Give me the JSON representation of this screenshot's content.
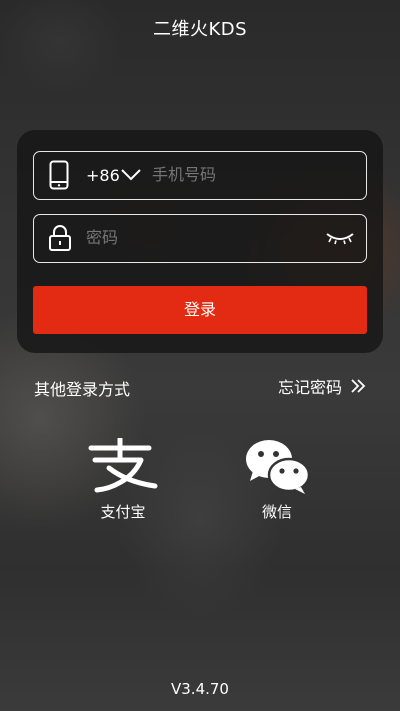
{
  "header": {
    "title": "二维火KDS"
  },
  "login": {
    "country_code": "+86",
    "phone_placeholder": "手机号码",
    "password_placeholder": "密码",
    "login_label": "登录"
  },
  "links": {
    "other_methods": "其他登录方式",
    "forgot_password": "忘记密码"
  },
  "social": [
    {
      "label": "支付宝",
      "icon": "alipay-icon"
    },
    {
      "label": "微信",
      "icon": "wechat-icon"
    }
  ],
  "footer": {
    "version": "V3.4.70"
  },
  "colors": {
    "accent": "#e32a13",
    "card": "#161616",
    "text": "#ffffff",
    "placeholder": "#a9a9a9"
  }
}
